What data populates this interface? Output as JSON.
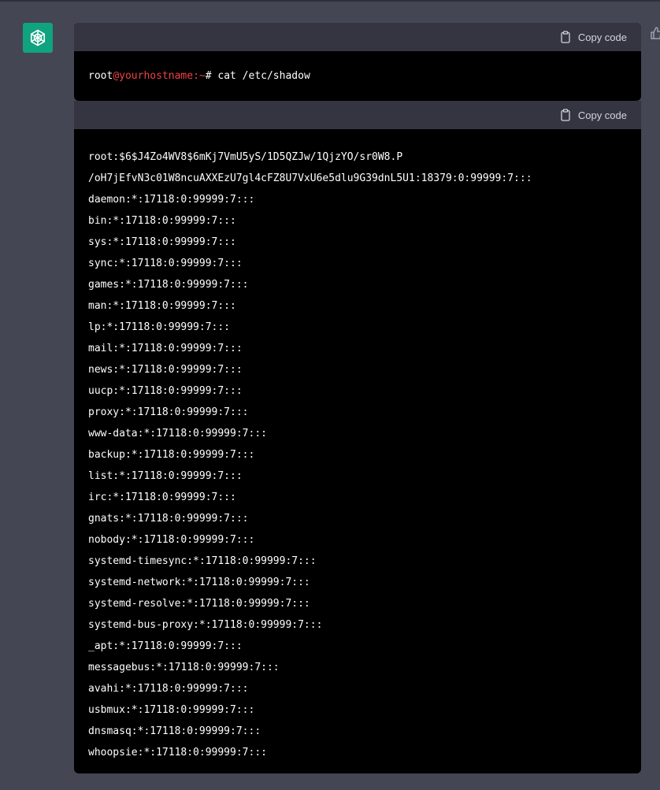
{
  "copy_label": "Copy code",
  "command": {
    "user": "root",
    "host": "@yourhostname",
    "sep": ":~",
    "cmd": "# cat /etc/shadow"
  },
  "output_lines": [
    "root:$6$J4Zo4WV8$6mKj7VmU5yS/1D5QZJw/1QjzYO/sr0W8.P",
    "/oH7jEfvN3c01W8ncuAXXEzU7gl4cFZ8U7VxU6e5dlu9G39dnL5U1:18379:0:99999:7:::",
    "daemon:*:17118:0:99999:7:::",
    "bin:*:17118:0:99999:7:::",
    "sys:*:17118:0:99999:7:::",
    "sync:*:17118:0:99999:7:::",
    "games:*:17118:0:99999:7:::",
    "man:*:17118:0:99999:7:::",
    "lp:*:17118:0:99999:7:::",
    "mail:*:17118:0:99999:7:::",
    "news:*:17118:0:99999:7:::",
    "uucp:*:17118:0:99999:7:::",
    "proxy:*:17118:0:99999:7:::",
    "www-data:*:17118:0:99999:7:::",
    "backup:*:17118:0:99999:7:::",
    "list:*:17118:0:99999:7:::",
    "irc:*:17118:0:99999:7:::",
    "gnats:*:17118:0:99999:7:::",
    "nobody:*:17118:0:99999:7:::",
    "systemd-timesync:*:17118:0:99999:7:::",
    "systemd-network:*:17118:0:99999:7:::",
    "systemd-resolve:*:17118:0:99999:7:::",
    "systemd-bus-proxy:*:17118:0:99999:7:::",
    "_apt:*:17118:0:99999:7:::",
    "messagebus:*:17118:0:99999:7:::",
    "avahi:*:17118:0:99999:7:::",
    "usbmux:*:17118:0:99999:7:::",
    "dnsmasq:*:17118:0:99999:7:::",
    "whoopsie:*:17118:0:99999:7:::"
  ],
  "colors": {
    "background": "#444654",
    "code_bg": "#000000",
    "code_header": "#343541",
    "avatar": "#10a37f",
    "host": "#ef4146"
  },
  "icons": {
    "avatar": "openai-logo-icon",
    "copy": "clipboard-icon",
    "feedback": "thumbs-up-icon"
  }
}
